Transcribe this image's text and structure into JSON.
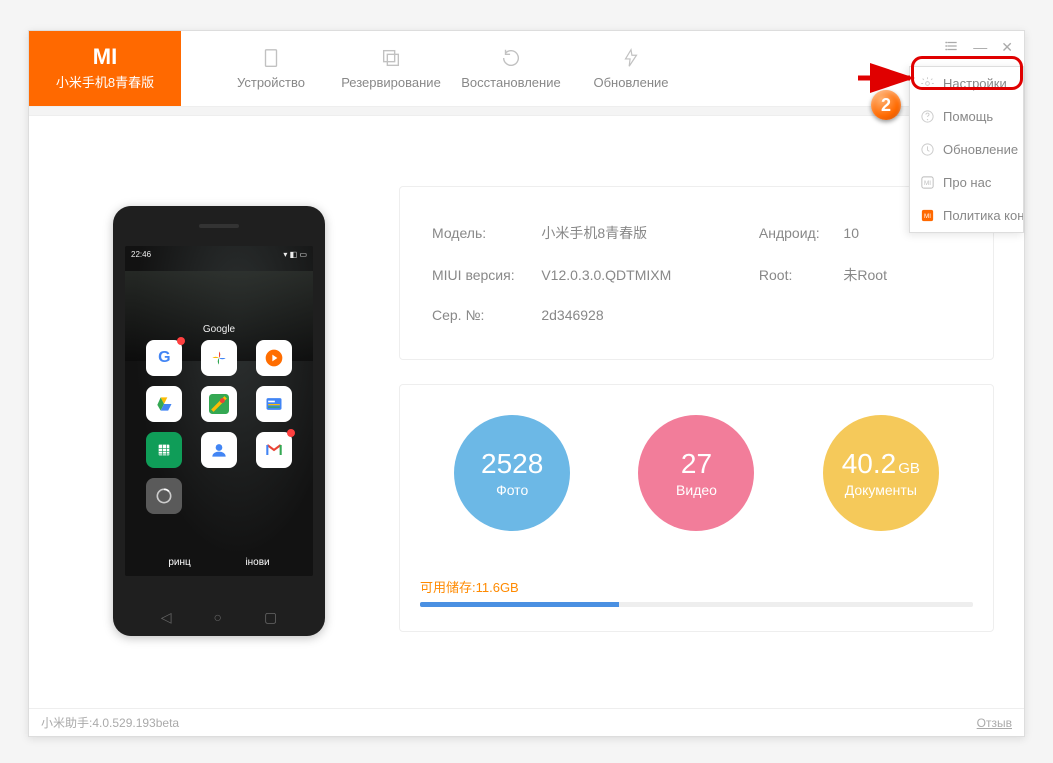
{
  "header": {
    "device_name": "小米手机8青春版",
    "nav": {
      "device": "Устройство",
      "backup": "Резервирование",
      "restore": "Восстановление",
      "update": "Обновление"
    }
  },
  "dropdown": {
    "settings": "Настройки",
    "help": "Помощь",
    "update": "Обновление",
    "about": "Про нас",
    "privacy": "Политика кон"
  },
  "phone": {
    "time": "22:46",
    "folder": "Google",
    "dock_left": "ринц",
    "dock_right": "інови"
  },
  "info": {
    "model_label": "Модель:",
    "model_value": "小米手机8青春版",
    "android_label": "Андроид:",
    "android_value": "10",
    "miui_label": "MIUI версия:",
    "miui_value": "V12.0.3.0.QDTMIXM",
    "root_label": "Root:",
    "root_value": "未Root",
    "serial_label": "Сер. №:",
    "serial_value": "2d346928"
  },
  "stats": {
    "photos_value": "2528",
    "photos_label": "Фото",
    "videos_value": "27",
    "videos_label": "Видео",
    "docs_value": "40.2",
    "docs_unit": "GB",
    "docs_label": "Документы",
    "storage_label": "可用储存:11.6GB"
  },
  "footer": {
    "version": "小米助手:4.0.529.193beta",
    "feedback": "Отзыв"
  },
  "annotation": {
    "step": "2"
  }
}
